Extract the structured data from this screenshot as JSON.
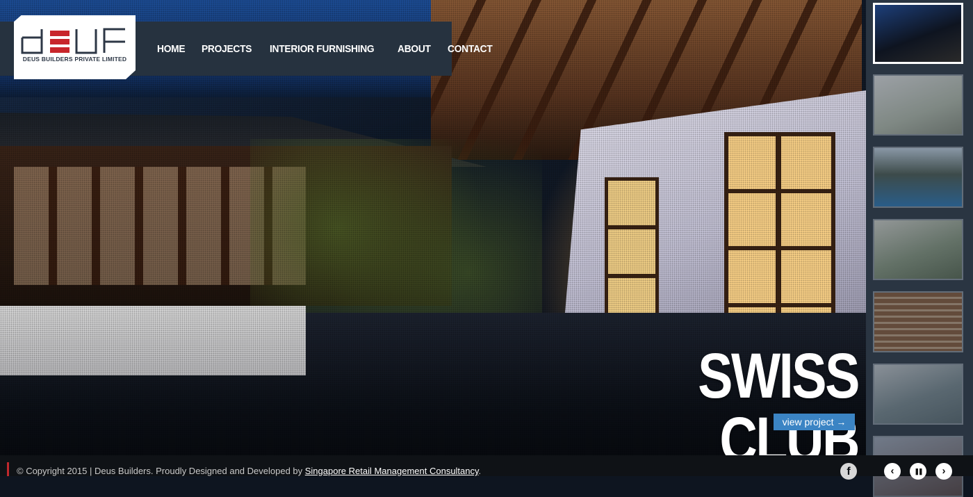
{
  "logo": {
    "text": "DEUS BUILDERS PRIVATE LIMITED",
    "colors": {
      "dark": "#2d3746",
      "red": "#c8262b"
    }
  },
  "nav": {
    "items": [
      "HOME",
      "PROJECTS",
      "INTERIOR FURNISHING",
      "ABOUT",
      "CONTACT"
    ]
  },
  "slide": {
    "title": "SWISS CLUB",
    "button_label": "view project →"
  },
  "thumbnails": {
    "count": 7,
    "active_index": 0
  },
  "footer": {
    "copyright": "© Copyright 2015 | Deus Builders. Proudly Designed and Developed by ",
    "link_text": "Singapore Retail Management Consultancy",
    "suffix": ".",
    "facebook_icon": "f",
    "prev_icon": "‹",
    "pause_icon": "❚❚",
    "next_icon": "›"
  },
  "colors": {
    "header_bg": "#26323f",
    "accent_blue": "#3b84c4",
    "accent_red": "#c0282d"
  }
}
